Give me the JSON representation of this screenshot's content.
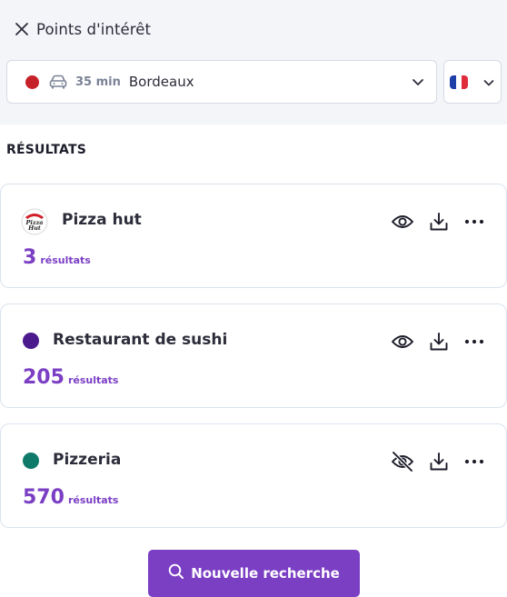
{
  "header": {
    "title": "Points d'intérêt"
  },
  "selector": {
    "duration": "35 min",
    "city": "Bordeaux",
    "dot_color": "#c62128"
  },
  "language": {
    "flag": "fr"
  },
  "results": {
    "section_title": "RÉSULTATS",
    "items": [
      {
        "name": "Pizza hut",
        "count": "3",
        "unit": "résultats",
        "marker": "pizza-hut-logo",
        "visible": true
      },
      {
        "name": "Restaurant de sushi",
        "count": "205",
        "unit": "résultats",
        "marker_color": "#4b1a8c",
        "visible": true
      },
      {
        "name": "Pizzeria",
        "count": "570",
        "unit": "résultats",
        "marker_color": "#0f7a6a",
        "visible": false
      }
    ]
  },
  "button": {
    "label": "Nouvelle recherche"
  },
  "colors": {
    "accent": "#7b3fc4",
    "panel": "#f4f5f9",
    "border": "#dbe3ee"
  }
}
